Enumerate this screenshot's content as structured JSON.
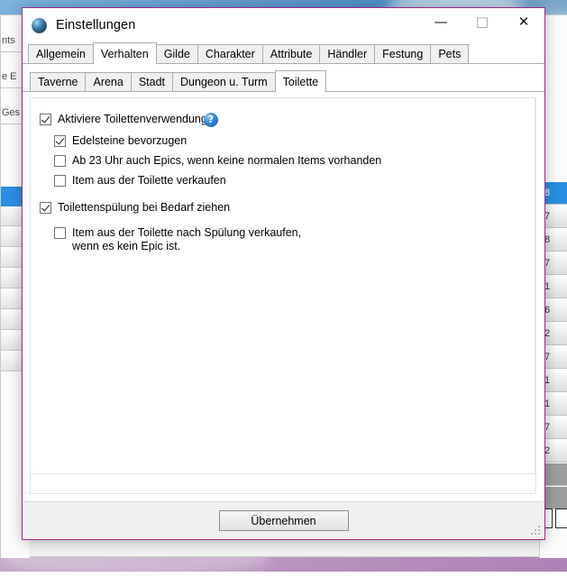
{
  "window": {
    "title": "Einstellungen",
    "icon": "globe-icon",
    "border_color": "#a0268c",
    "controls": {
      "minimize": "—",
      "maximize": "□",
      "close": "✕"
    }
  },
  "tabs_primary": {
    "items": [
      {
        "label": "Allgemein",
        "active": false
      },
      {
        "label": "Verhalten",
        "active": true
      },
      {
        "label": "Gilde",
        "active": false
      },
      {
        "label": "Charakter",
        "active": false
      },
      {
        "label": "Attribute",
        "active": false
      },
      {
        "label": "Händler",
        "active": false
      },
      {
        "label": "Festung",
        "active": false
      },
      {
        "label": "Pets",
        "active": false
      }
    ]
  },
  "tabs_secondary": {
    "items": [
      {
        "label": "Taverne",
        "active": false
      },
      {
        "label": "Arena",
        "active": false
      },
      {
        "label": "Stadt",
        "active": false
      },
      {
        "label": "Dungeon u. Turm",
        "active": false
      },
      {
        "label": "Toilette",
        "active": true
      }
    ]
  },
  "options": [
    {
      "id": "aktiviere-toilettenverwendung",
      "label": "Aktiviere Toilettenverwendung",
      "checked": true,
      "indent": 0,
      "help": "?"
    },
    {
      "id": "edelsteine-bevorzugen",
      "label": "Edelsteine bevorzugen",
      "checked": true,
      "indent": 1
    },
    {
      "id": "ab-23-uhr-auch-epics",
      "label": "Ab 23 Uhr auch Epics, wenn keine normalen Items vorhanden",
      "checked": false,
      "indent": 1
    },
    {
      "id": "item-aus-toilette-verkaufen",
      "label": "Item aus der Toilette verkaufen",
      "checked": false,
      "indent": 1
    },
    {
      "id": "toilettenspuelung-bei-bedarf-ziehen",
      "label": "Toilettenspülung bei Bedarf ziehen",
      "checked": true,
      "indent": 0
    },
    {
      "id": "item-nach-spuelung-verkaufen",
      "label": "Item aus der Toilette nach Spülung verkaufen,\nwenn es kein Epic ist.",
      "checked": false,
      "indent": 1
    }
  ],
  "footer": {
    "apply_label": "Übernehmen"
  },
  "background": {
    "left_fragments": [
      "nts",
      "e E",
      "Ges"
    ],
    "right_rows": [
      "8",
      "7",
      "8",
      "7",
      "1",
      "6",
      "2",
      "7",
      "1",
      "1",
      "7",
      "2",
      "",
      ""
    ]
  }
}
